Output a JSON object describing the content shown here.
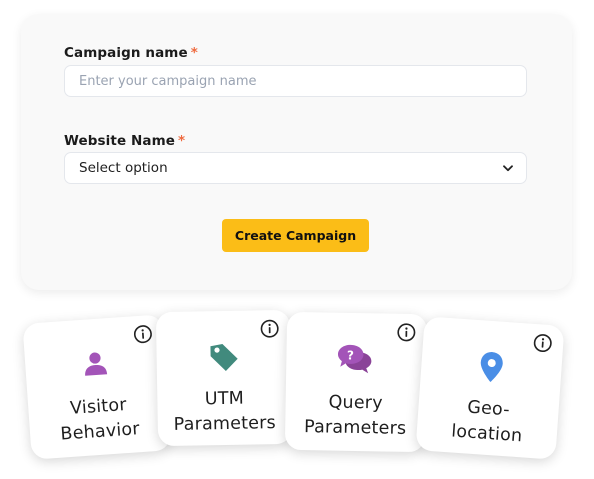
{
  "form": {
    "campaign_name_label": "Campaign name",
    "campaign_name_required": "*",
    "campaign_name_placeholder": "Enter your campaign name",
    "website_name_label": "Website Name",
    "website_name_required": "*",
    "website_select_value": "Select option",
    "create_button_label": "Create Campaign"
  },
  "tiles": [
    {
      "label_line1": "Visitor",
      "label_line2": "Behavior",
      "icon": "person-icon",
      "icon_color": "#a354b8"
    },
    {
      "label_line1": "UTM",
      "label_line2": "Parameters",
      "icon": "tag-icon",
      "icon_color": "#418a7d"
    },
    {
      "label_line1": "Query",
      "label_line2": "Parameters",
      "icon": "question-chat-icon",
      "icon_color": "#9b4ea6"
    },
    {
      "label_line1": "Geo-",
      "label_line2": "location",
      "icon": "location-pin-icon",
      "icon_color": "#4a8ee6"
    }
  ],
  "colors": {
    "accent": "#fbbd17",
    "required": "#ef6a3f",
    "card_bg": "#f9f9f9"
  }
}
